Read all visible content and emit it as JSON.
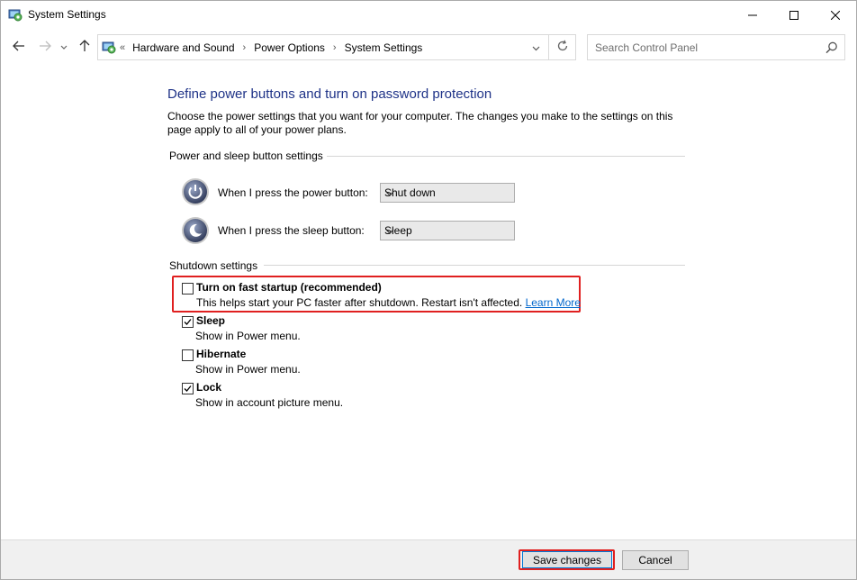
{
  "window": {
    "title": "System Settings"
  },
  "nav": {
    "breadcrumbs": [
      "Hardware and Sound",
      "Power Options",
      "System Settings"
    ],
    "search_placeholder": "Search Control Panel"
  },
  "main": {
    "heading": "Define power buttons and turn on password protection",
    "description": "Choose the power settings that you want for your computer. The changes you make to the settings on this page apply to all of your power plans.",
    "power_section_label": "Power and sleep button settings",
    "power_button_label": "When I press the power button:",
    "power_button_value": "Shut down",
    "sleep_button_label": "When I press the sleep button:",
    "sleep_button_value": "Sleep",
    "shutdown_section_label": "Shutdown settings",
    "options": [
      {
        "title": "Turn on fast startup (recommended)",
        "subtitle": "This helps start your PC faster after shutdown. Restart isn't affected.",
        "link": "Learn More",
        "checked": false
      },
      {
        "title": "Sleep",
        "subtitle": "Show in Power menu.",
        "checked": true
      },
      {
        "title": "Hibernate",
        "subtitle": "Show in Power menu.",
        "checked": false
      },
      {
        "title": "Lock",
        "subtitle": "Show in account picture menu.",
        "checked": true
      }
    ]
  },
  "footer": {
    "save_label": "Save changes",
    "cancel_label": "Cancel"
  },
  "colors": {
    "heading": "#1e3287",
    "link": "#0066cc",
    "highlight": "#e02020"
  },
  "icons": [
    "control-panel-icon",
    "back-arrow-icon",
    "forward-arrow-icon",
    "chevron-down-icon",
    "up-arrow-icon",
    "refresh-icon",
    "search-icon",
    "power-icon",
    "sleep-icon",
    "checkmark-icon",
    "minimize-icon",
    "maximize-icon",
    "close-icon"
  ]
}
